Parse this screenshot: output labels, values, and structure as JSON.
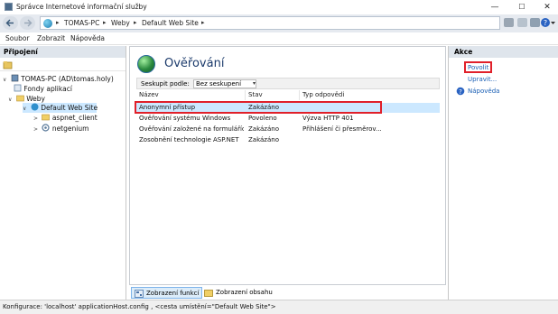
{
  "window": {
    "title": "Správce Internetové informační služby",
    "controls": {
      "minimize": "—",
      "maximize": "☐",
      "close": "✕"
    }
  },
  "address_bar": {
    "breadcrumbs": [
      "TOMAS-PC",
      "Weby",
      "Default Web Site"
    ],
    "separator": "▸"
  },
  "menu": {
    "items": [
      "Soubor",
      "Zobrazit",
      "Nápověda"
    ]
  },
  "connections": {
    "title": "Připojení",
    "tree": [
      {
        "label": "TOMAS-PC (AD\\tomas.holy)",
        "icon": "server-icon",
        "expander": "∨"
      },
      {
        "label": "Fondy aplikací",
        "icon": "app-pools-icon",
        "expander": ""
      },
      {
        "label": "Weby",
        "icon": "folder-icon",
        "expander": "∨"
      },
      {
        "label": "Default Web Site",
        "icon": "globe-icon",
        "expander": "∨",
        "selected": true
      },
      {
        "label": "aspnet_client",
        "icon": "folder-icon",
        "expander": ">"
      },
      {
        "label": "netgenium",
        "icon": "application-icon",
        "expander": ">"
      }
    ]
  },
  "feature": {
    "title": "Ověřování",
    "group_by_label": "Seskupit podle:",
    "group_by_value": "Bez seskupení",
    "columns": [
      "Název",
      "Stav",
      "Typ odpovědi"
    ],
    "rows": [
      {
        "name": "Anonymní přístup",
        "status": "Zakázáno",
        "response": "",
        "selected": true
      },
      {
        "name": "Ověřování systému Windows",
        "status": "Povoleno",
        "response": "Výzva HTTP 401"
      },
      {
        "name": "Ověřování založené na formulářích",
        "status": "Zakázáno",
        "response": "Přihlášení či přesměrov..."
      },
      {
        "name": "Zosobnění technologie ASP.NET",
        "status": "Zakázáno",
        "response": ""
      }
    ],
    "tabs": [
      "Zobrazení funkcí",
      "Zobrazení obsahu"
    ]
  },
  "actions": {
    "title": "Akce",
    "enable": "Povolit",
    "edit": "Upravit...",
    "help": "Nápověda"
  },
  "status_bar": {
    "text": "Konfigurace: 'localhost' applicationHost.config , <cesta umístění=\"Default Web Site\">"
  },
  "colors": {
    "header_bg": "#dfe5ec",
    "selection": "#cce8ff",
    "highlight": "#e0202a",
    "link": "#1a5fb4",
    "title_blue": "#1b3a6b"
  }
}
